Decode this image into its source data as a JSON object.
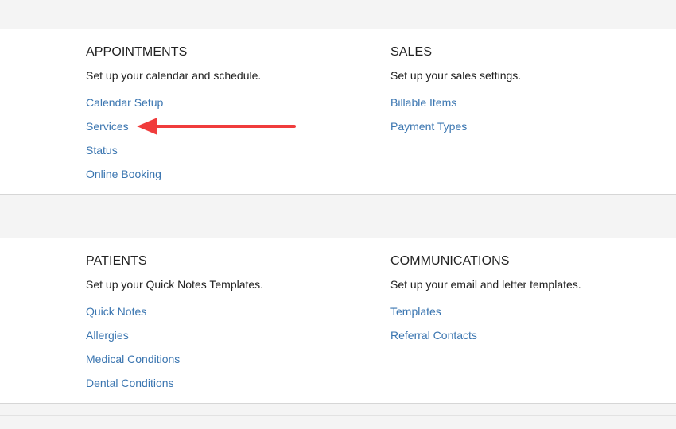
{
  "sections": [
    {
      "title": "APPOINTMENTS",
      "description": "Set up your calendar and schedule.",
      "links": [
        "Calendar Setup",
        "Services",
        "Status",
        "Online Booking"
      ]
    },
    {
      "title": "SALES",
      "description": "Set up your sales settings.",
      "links": [
        "Billable Items",
        "Payment Types"
      ]
    },
    {
      "title": "PATIENTS",
      "description": "Set up your Quick Notes Templates.",
      "links": [
        "Quick Notes",
        "Allergies",
        "Medical Conditions",
        "Dental Conditions"
      ]
    },
    {
      "title": "COMMUNICATIONS",
      "description": "Set up your email and letter templates.",
      "links": [
        "Templates",
        "Referral Contacts"
      ]
    }
  ],
  "annotation": {
    "arrow_color": "#f03c3c",
    "points_to": "Services"
  },
  "colors": {
    "link": "#3a75b0",
    "heading": "#222222",
    "page_background": "#f4f4f4",
    "panel_background": "#ffffff"
  }
}
